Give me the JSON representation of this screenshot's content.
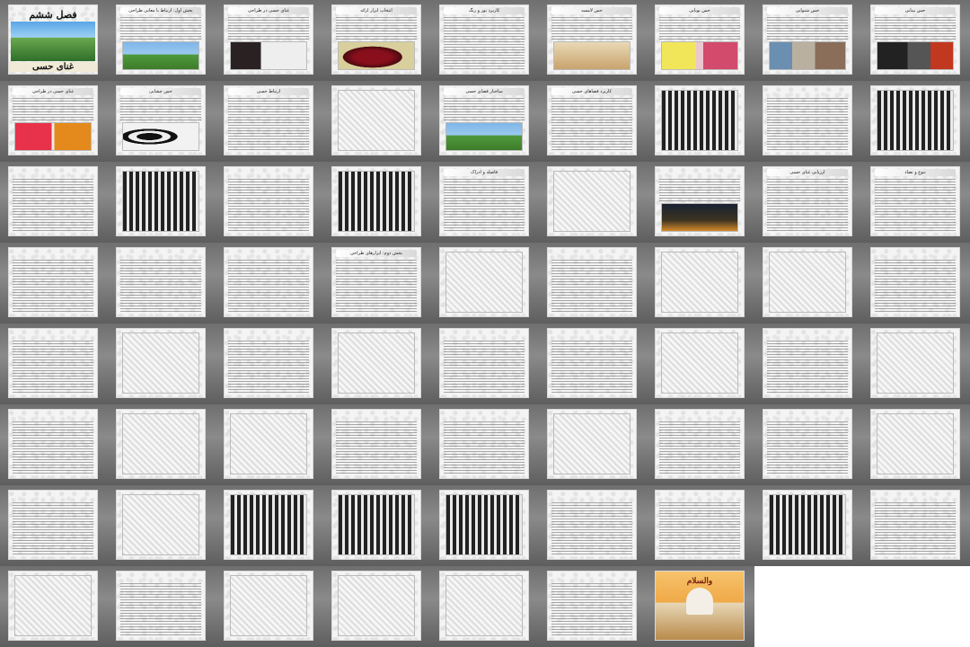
{
  "app": {
    "first_slide_title": "فصل ششم",
    "first_slide_subtitle": "غنای حسی",
    "last_slide_title": "والسلام"
  },
  "slides": [
    {
      "title": "",
      "kind": "first"
    },
    {
      "title": "بخش اول: ارتباط با معانی طراحی",
      "kind": "half",
      "img": "landscape"
    },
    {
      "title": "غنای حسی در طراحی",
      "kind": "half",
      "img": "face"
    },
    {
      "title": "انتخاب ابزار ارائه",
      "kind": "half",
      "img": "rose"
    },
    {
      "title": "کاربرد نور و رنگ",
      "kind": "text"
    },
    {
      "title": "حس لامسه",
      "kind": "half",
      "img": "hand"
    },
    {
      "title": "حس بویایی",
      "kind": "half",
      "img": "flower"
    },
    {
      "title": "حس شنوایی",
      "kind": "half",
      "img": "city"
    },
    {
      "title": "حس بینایی",
      "kind": "half",
      "img": "dark"
    },
    {
      "title": "غنای حسی در طراحی",
      "kind": "half",
      "img": "fruit"
    },
    {
      "title": "حس چشایی",
      "kind": "half",
      "img": "glasses"
    },
    {
      "title": "ارتباط حسی",
      "kind": "text"
    },
    {
      "title": "",
      "kind": "big-img",
      "img": "sketch"
    },
    {
      "title": "ساختار فضای حسی",
      "kind": "half",
      "img": "landscape"
    },
    {
      "title": "کاربرد فضاهای حسی",
      "kind": "text"
    },
    {
      "title": "",
      "kind": "big-img",
      "img": "window"
    },
    {
      "title": "",
      "kind": "text"
    },
    {
      "title": "",
      "kind": "big-img",
      "img": "window"
    },
    {
      "title": "",
      "kind": "text"
    },
    {
      "title": "",
      "kind": "big-img",
      "img": "window"
    },
    {
      "title": "",
      "kind": "text"
    },
    {
      "title": "",
      "kind": "big-img",
      "img": "window"
    },
    {
      "title": "فاصله و ادراک",
      "kind": "text"
    },
    {
      "title": "",
      "kind": "big-img",
      "img": "sketch"
    },
    {
      "title": "",
      "kind": "half",
      "img": "night"
    },
    {
      "title": "ارزیابی غنای حسی",
      "kind": "text"
    },
    {
      "title": "تنوع و تضاد",
      "kind": "text"
    },
    {
      "title": "",
      "kind": "text"
    },
    {
      "title": "",
      "kind": "text"
    },
    {
      "title": "",
      "kind": "text"
    },
    {
      "title": "بخش دوم: ابزارهای طراحی",
      "kind": "text"
    },
    {
      "title": "",
      "kind": "big-img",
      "img": "sketch"
    },
    {
      "title": "",
      "kind": "text"
    },
    {
      "title": "",
      "kind": "big-img",
      "img": "sketch"
    },
    {
      "title": "",
      "kind": "big-img",
      "img": "sketch"
    },
    {
      "title": "",
      "kind": "text"
    },
    {
      "title": "",
      "kind": "text"
    },
    {
      "title": "",
      "kind": "big-img",
      "img": "sketch"
    },
    {
      "title": "",
      "kind": "text"
    },
    {
      "title": "",
      "kind": "big-img",
      "img": "sketch"
    },
    {
      "title": "",
      "kind": "text"
    },
    {
      "title": "",
      "kind": "text"
    },
    {
      "title": "",
      "kind": "big-img",
      "img": "sketch"
    },
    {
      "title": "",
      "kind": "text"
    },
    {
      "title": "",
      "kind": "big-img",
      "img": "sketch"
    },
    {
      "title": "",
      "kind": "text"
    },
    {
      "title": "",
      "kind": "big-img",
      "img": "sketch"
    },
    {
      "title": "",
      "kind": "big-img",
      "img": "sketch"
    },
    {
      "title": "",
      "kind": "text"
    },
    {
      "title": "",
      "kind": "text"
    },
    {
      "title": "",
      "kind": "big-img",
      "img": "sketch"
    },
    {
      "title": "",
      "kind": "text"
    },
    {
      "title": "",
      "kind": "text"
    },
    {
      "title": "",
      "kind": "big-img",
      "img": "sketch"
    },
    {
      "title": "",
      "kind": "text"
    },
    {
      "title": "",
      "kind": "big-img",
      "img": "sketch"
    },
    {
      "title": "",
      "kind": "big-img",
      "img": "window"
    },
    {
      "title": "",
      "kind": "big-img",
      "img": "window"
    },
    {
      "title": "",
      "kind": "big-img",
      "img": "window"
    },
    {
      "title": "",
      "kind": "text"
    },
    {
      "title": "",
      "kind": "text"
    },
    {
      "title": "",
      "kind": "big-img",
      "img": "window"
    },
    {
      "title": "",
      "kind": "text"
    },
    {
      "title": "",
      "kind": "big-img",
      "img": "sketch"
    },
    {
      "title": "",
      "kind": "text"
    },
    {
      "title": "",
      "kind": "big-img",
      "img": "sketch"
    },
    {
      "title": "",
      "kind": "big-img",
      "img": "sketch"
    },
    {
      "title": "",
      "kind": "big-img",
      "img": "sketch"
    },
    {
      "title": "",
      "kind": "text"
    },
    {
      "title": "",
      "kind": "last"
    }
  ]
}
